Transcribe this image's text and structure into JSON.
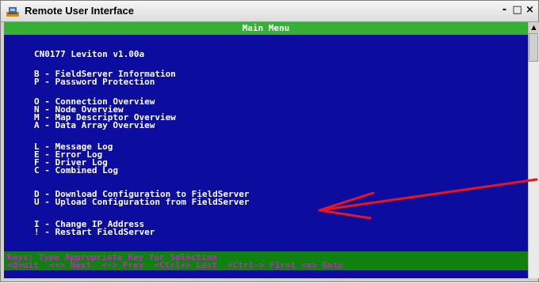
{
  "window": {
    "title": "Remote User Interface",
    "controls": {
      "minimize": "-",
      "maximize": "□",
      "close": "×"
    }
  },
  "terminal": {
    "header": "Main Menu",
    "device": "CN0177 Leviton v1.00a",
    "menu": [
      "B - FieldServer Information",
      "P - Password Protection",
      "O - Connection Overview",
      "N - Node Overview",
      "M - Map Descriptor Overview",
      "A - Data Array Overview",
      "L - Message Log",
      "E - Error Log",
      "F - Driver Log",
      "C - Combined Log",
      "D - Download Configuration to FieldServer",
      "U - Upload Configuration from FieldServer",
      "I - Change IP Address",
      "! - Restart FieldServer"
    ],
    "keys": {
      "line1": "Keys: Type Appropriate Key for Selection",
      "line2": "<Q>uit  <+> Next  <-> Prev  <Ctrl+> Last  <Ctrl-> First <n> Goto"
    }
  },
  "scrollbar": {
    "up_arrow": "▲"
  },
  "annotation": {
    "color": "#e8161a",
    "icon": "red-arrow-annotation"
  }
}
